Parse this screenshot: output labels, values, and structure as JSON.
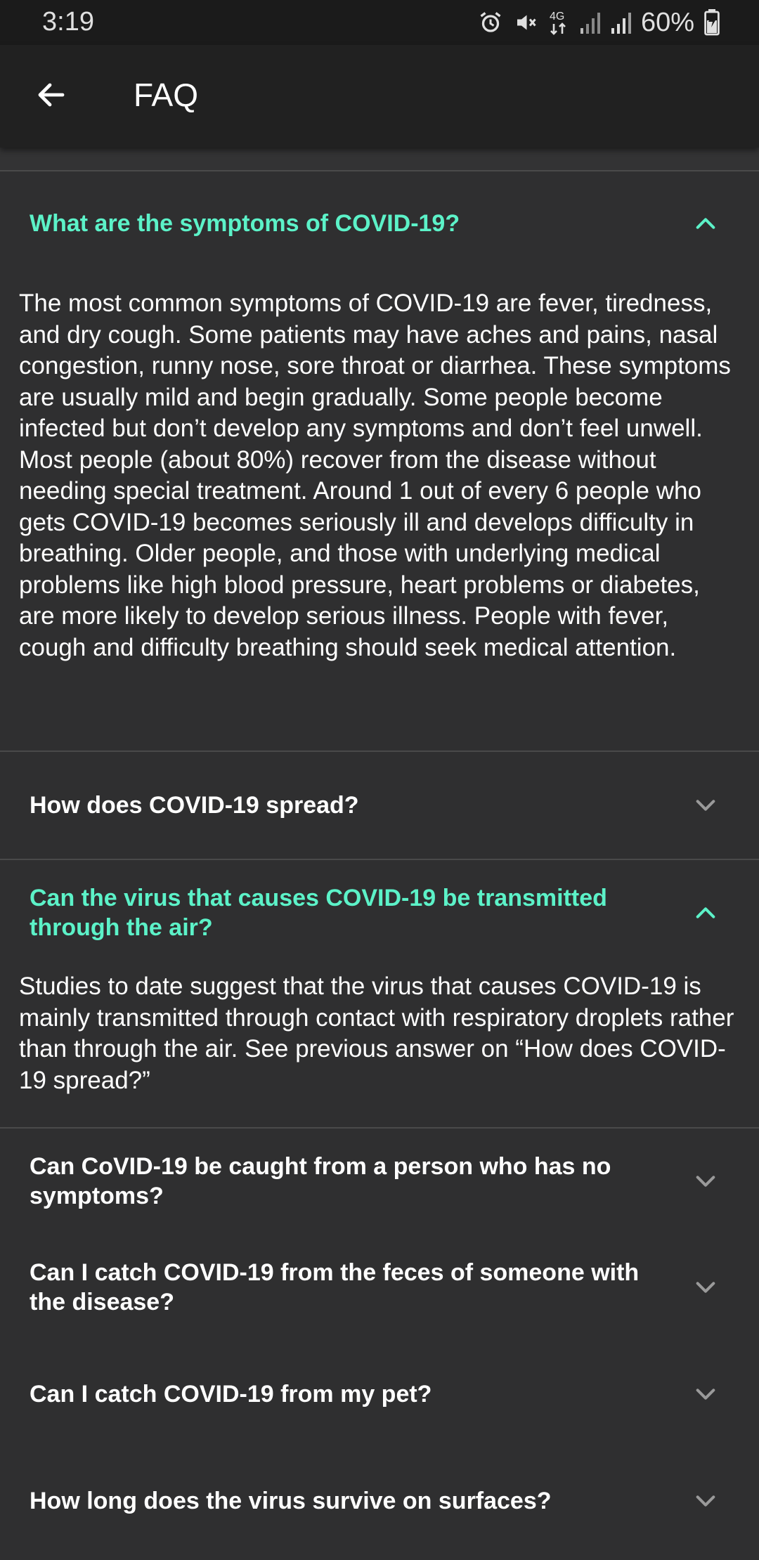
{
  "status_bar": {
    "time": "3:19",
    "battery": "60%",
    "network": "4G",
    "icons": [
      "alarm-icon",
      "mute-icon",
      "network-4g-icon",
      "signal-icon",
      "signal-icon",
      "battery-icon"
    ]
  },
  "app_bar": {
    "title": "FAQ",
    "back_icon": "arrow-left-icon"
  },
  "colors": {
    "background": "#2f2f30",
    "app_bar": "#212121",
    "status_bar": "#1b1b1b",
    "accent": "#5cf2c8",
    "text": "#ffffff",
    "divider": "#4a4a4a"
  },
  "faq": {
    "items": [
      {
        "question": "What are the symptoms of COVID-19?",
        "expanded": true,
        "answer": "The most common symptoms of COVID-19 are fever, tiredness, and dry cough. Some patients may have aches and pains, nasal congestion, runny nose, sore throat or diarrhea. These symptoms are usually mild and begin gradually. Some people become infected but don’t develop any symptoms and don’t feel unwell. Most people (about 80%) recover from the disease without needing special treatment. Around 1 out of every 6 people who gets COVID-19 becomes seriously ill and develops difficulty in breathing. Older people, and those with underlying medical problems like high blood pressure, heart problems or diabetes, are more likely to develop serious illness. People with fever, cough and difficulty breathing should seek medical attention."
      },
      {
        "question": "How does COVID-19 spread?",
        "expanded": false
      },
      {
        "question": "Can the virus that causes COVID-19 be transmitted through the air?",
        "expanded": true,
        "answer": "Studies to date suggest that the virus that causes COVID-19 is mainly transmitted through contact with respiratory droplets rather than through the air. See previous answer on “How does COVID-19 spread?”"
      },
      {
        "question": "Can CoVID-19 be caught from a person who has no symptoms?",
        "expanded": false
      },
      {
        "question": "Can I catch COVID-19 from the feces of someone with the disease?",
        "expanded": false
      },
      {
        "question": "Can I catch COVID-19 from my pet?",
        "expanded": false
      },
      {
        "question": "How long does the virus survive on surfaces?",
        "expanded": false
      }
    ]
  }
}
